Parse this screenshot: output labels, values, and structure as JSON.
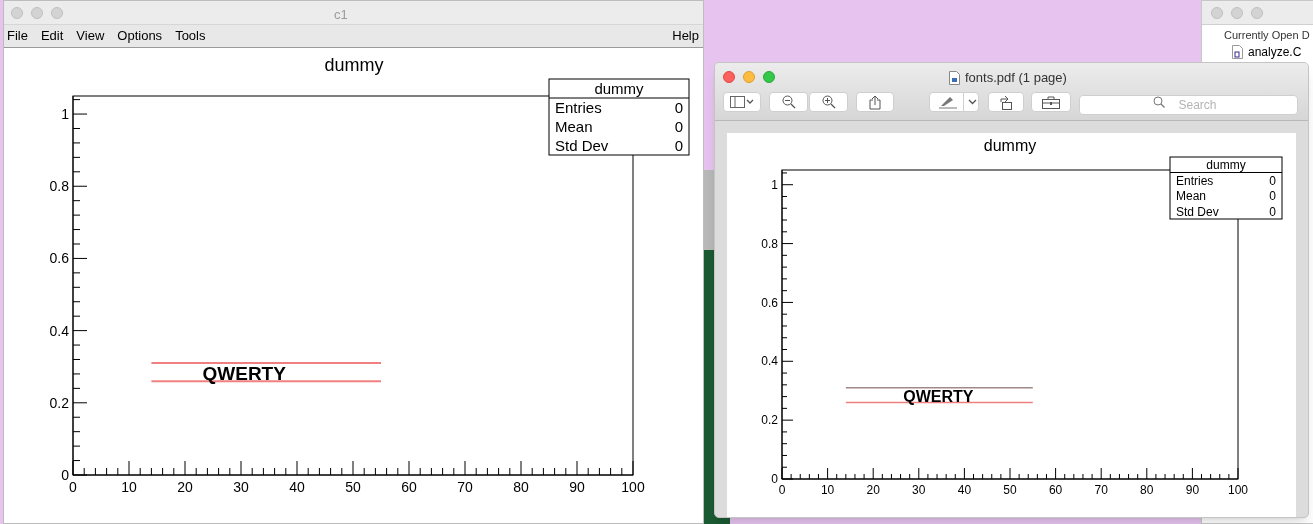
{
  "browser_window": {
    "header": "Currently Open D",
    "files": [
      "analyze.C"
    ]
  },
  "canvas_window": {
    "title": "c1",
    "menu": [
      "File",
      "Edit",
      "View",
      "Options",
      "Tools"
    ],
    "help_menu": "Help",
    "chart_data": {
      "type": "line",
      "title": "dummy",
      "xlim": [
        0,
        100
      ],
      "ylim": [
        0,
        1.05
      ],
      "xticks": [
        0,
        10,
        20,
        30,
        40,
        50,
        60,
        70,
        80,
        90,
        100
      ],
      "yticks": [
        0,
        0.2,
        0.4,
        0.6,
        0.8,
        1
      ],
      "x": [
        14,
        55
      ],
      "series": [
        {
          "color": "#f08080",
          "values": [
            0.31,
            0.31
          ]
        },
        {
          "color": "#f08080",
          "values": [
            0.26,
            0.26
          ]
        }
      ],
      "annotations": [
        "QWERTY"
      ]
    },
    "stats": {
      "title": "dummy",
      "rows": [
        {
          "label": "Entries",
          "value": "0"
        },
        {
          "label": "Mean",
          "value": "0"
        },
        {
          "label": "Std Dev",
          "value": "0"
        }
      ]
    }
  },
  "preview_window": {
    "title": "fonts.pdf (1 page)",
    "search": {
      "placeholder": "Search"
    },
    "chart_data": {
      "type": "line",
      "title": "dummy",
      "xlim": [
        0,
        100
      ],
      "ylim": [
        0,
        1.05
      ],
      "xticks": [
        0,
        10,
        20,
        30,
        40,
        50,
        60,
        70,
        80,
        90,
        100
      ],
      "yticks": [
        0,
        0.2,
        0.4,
        0.6,
        0.8,
        1
      ],
      "x": [
        14,
        55
      ],
      "series": [
        {
          "color": "#a08888",
          "values": [
            0.31,
            0.31
          ]
        },
        {
          "color": "#f08080",
          "values": [
            0.26,
            0.26
          ]
        }
      ],
      "annotations": [
        "QWERTY"
      ]
    },
    "stats": {
      "title": "dummy",
      "rows": [
        {
          "label": "Entries",
          "value": "0"
        },
        {
          "label": "Mean",
          "value": "0"
        },
        {
          "label": "Std Dev",
          "value": "0"
        }
      ]
    }
  }
}
